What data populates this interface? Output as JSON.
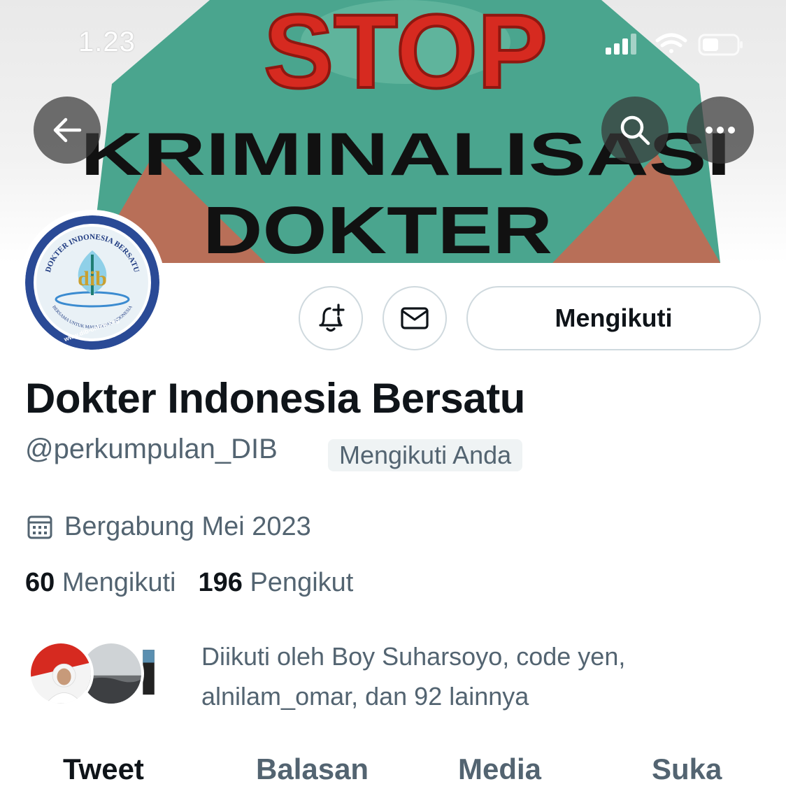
{
  "status_bar": {
    "time": "1.23"
  },
  "banner": {
    "line1": "STOP",
    "line2": "KRIMINALISASI",
    "line3": "DOKTER"
  },
  "avatar": {
    "ring_text_top": "DOKTER INDONESIA BERSATU",
    "ring_text_bottom": "BERSAMA UNTUK MASA DEPAN INDONESIA",
    "website": "www.dib-online.org",
    "monogram": "dib"
  },
  "actions": {
    "follow_label": "Mengikuti"
  },
  "profile": {
    "name": "Dokter Indonesia Bersatu",
    "handle": "@perkumpulan_DIB",
    "follows_you": "Mengikuti Anda",
    "joined": "Bergabung Mei 2023"
  },
  "stats": {
    "following_count": "60",
    "following_label": "Mengikuti",
    "followers_count": "196",
    "followers_label": "Pengikut"
  },
  "followed_by": {
    "text": "Diikuti oleh Boy Suharsoyo, code yen, alnilam_omar, dan 92 lainnya"
  },
  "tabs": [
    "Tweet",
    "Balasan",
    "Media",
    "Suka"
  ],
  "colors": {
    "text": "#0f1419",
    "muted": "#536471",
    "border": "#cfd9de",
    "chip": "#eff3f4"
  }
}
